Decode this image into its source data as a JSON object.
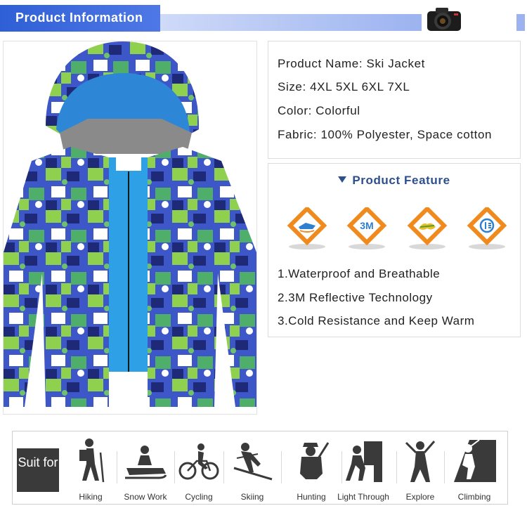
{
  "header": {
    "title": "Product Information",
    "camera_icon": "camera-icon"
  },
  "info": {
    "name": "Product Name: Ski Jacket",
    "size": "Size: 4XL 5XL 6XL 7XL",
    "color": "Color: Colorful",
    "fabric": "Fabric: 100% Polyester, Space cotton"
  },
  "features": {
    "title": "Product Feature",
    "badges": [
      "waterproof-badge-icon",
      "3m-badge-icon",
      "breathable-badge-icon",
      "cold-resistance-badge-icon"
    ],
    "badge_3m_text": "3M",
    "items": [
      "1.Waterproof and Breathable",
      "2.3M Reflective Technology",
      "3.Cold Resistance and Keep Warm"
    ]
  },
  "suit": {
    "label": "Suit for",
    "activities": [
      "Hiking",
      "Snow Work",
      "Cycling",
      "Skiing",
      "Hunting",
      "Light Through",
      "Explore",
      "Climbing"
    ]
  },
  "colors": {
    "header": "#2f5fd6",
    "feature_title": "#2d4f8e",
    "badge": "#f08a1c"
  }
}
